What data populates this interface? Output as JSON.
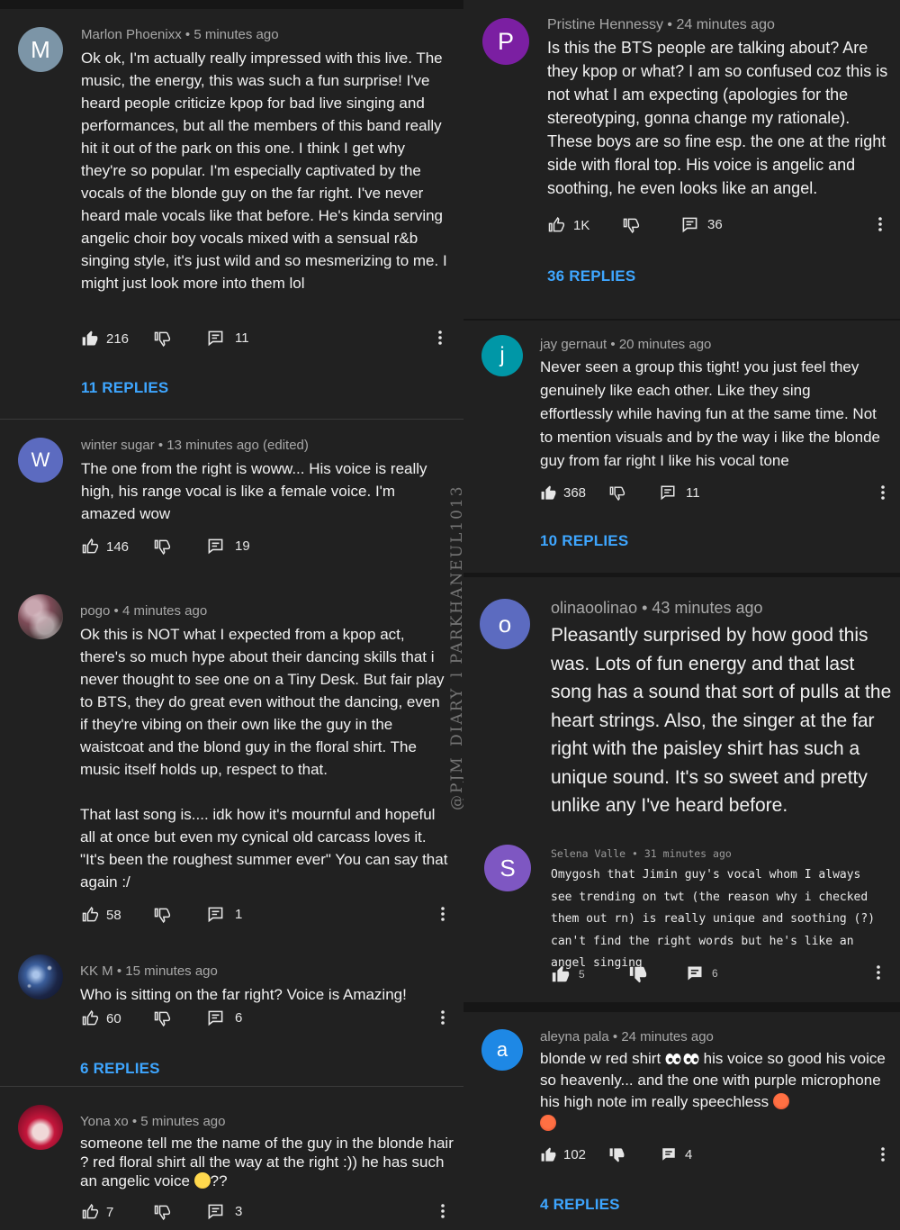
{
  "watermark": "@PJM_DIARY_l PARKHANEUL1013",
  "comments": [
    {
      "author": "Marlon Phoenixx",
      "time": "5 minutes ago",
      "avatar_letter": "M",
      "avatar_color": "#7c95a7",
      "text": "Ok ok, I'm actually really impressed with this live. The music, the energy, this was such a fun surprise! I've heard people criticize kpop for bad live singing and performances, but all the members of this band really hit it out of the park on this one. I think I get why they're so popular. I'm especially captivated by the vocals of the blonde guy on the far right. I've never heard male vocals like that before. He's kinda serving angelic choir boy vocals mixed with a sensual r&b singing style, it's just wild and so mesmerizing to me. I might just look more into them lol",
      "likes": "216",
      "reply_count": "11",
      "replies_link": "11 REPLIES"
    },
    {
      "author": "winter sugar",
      "time": "13 minutes ago (edited)",
      "avatar_letter": "W",
      "avatar_color": "#5c6bc0",
      "text": "The one from the right is woww... His voice is really high, his range vocal is like a female voice. I'm amazed wow",
      "likes": "146",
      "reply_count": "19"
    },
    {
      "author": "pogo",
      "time": "4 minutes ago",
      "avatar_icon": "flower-photo",
      "text": "Ok this is NOT what I expected from a kpop act, there's so much hype about their dancing skills that i never thought to see one on a Tiny Desk. But fair play to BTS, they do great even without the dancing, even if they're vibing on their own like the guy in the waistcoat and the blond guy in the floral shirt. The music itself holds up, respect to that.",
      "text2": "That last song is.... idk how it's mournful and hopeful all at once but even my cynical old carcass loves it. \"It's been the roughest summer ever\" You can say that again :/",
      "likes": "58",
      "reply_count": "1"
    },
    {
      "author": "KK M",
      "time": "15 minutes ago",
      "avatar_icon": "galaxy-photo",
      "text": "Who is sitting on the far right? Voice is Amazing!",
      "likes": "60",
      "reply_count": "6",
      "replies_link": "6 REPLIES"
    },
    {
      "author": "Yona xo",
      "time": "5 minutes ago",
      "avatar_icon": "anime-photo",
      "text_before_emoji": "someone tell me the name of the guy in the blonde hair ? red floral shirt all the way at the right :)) he has such an angelic voice ",
      "emoji": "pleading-face-emoji",
      "text_after_emoji": "??",
      "likes": "7",
      "reply_count": "3"
    },
    {
      "author": "Pristine Hennessy",
      "time": "24 minutes ago",
      "avatar_letter": "P",
      "avatar_color": "#7b1fa2",
      "text": "Is this the BTS people are talking about? Are they kpop or what? I am so confused coz this is not what I am expecting (apologies for the stereotyping, gonna change my rationale). These boys are so fine esp. the one at the right side with floral top. His voice is angelic and soothing, he even looks like an angel.",
      "likes": "1K",
      "reply_count": "36",
      "replies_link": "36 REPLIES"
    },
    {
      "author": "jay gernaut",
      "time": "20 minutes ago",
      "avatar_letter": "j",
      "avatar_color": "#0097a7",
      "text": "Never seen a group this tight! you just feel they genuinely like each other. Like they sing effortlessly while having fun at the same time. Not to mention visuals and by the way i like the blonde guy from far right I like his vocal tone",
      "likes": "368",
      "reply_count": "11",
      "replies_link": "10 REPLIES"
    },
    {
      "author": "olinaoolinao",
      "time": "43 minutes ago",
      "avatar_letter": "o",
      "avatar_color": "#5c6bc0",
      "text": "Pleasantly surprised by how good this was.  Lots of fun energy and that last song has a sound that sort of pulls at the heart strings.  Also, the singer at the far right with the paisley shirt has such a unique sound.  It's so sweet and pretty unlike any I've heard before."
    },
    {
      "author": "Selena Valle",
      "time": "31 minutes ago",
      "avatar_letter": "S",
      "avatar_color": "#7e57c2",
      "text": "Omygosh that Jimin guy's vocal whom I always see trending on twt (the reason why i checked them out rn) is really unique and soothing (?) can't find the right words but he's like an angel singing",
      "likes": "5",
      "reply_count": "6"
    },
    {
      "author": "aleyna pala",
      "time": "24 minutes ago",
      "avatar_letter": "a",
      "avatar_color": "#1e88e5",
      "text_before_emoji": "blonde w red shirt ",
      "text_mid": " his voice so good  his voice so heavenly... and the one with purple microphone his high note im really speechless ",
      "emoji": "hot-face-emoji",
      "likes": "102",
      "reply_count": "4",
      "replies_link": "4 REPLIES"
    }
  ]
}
